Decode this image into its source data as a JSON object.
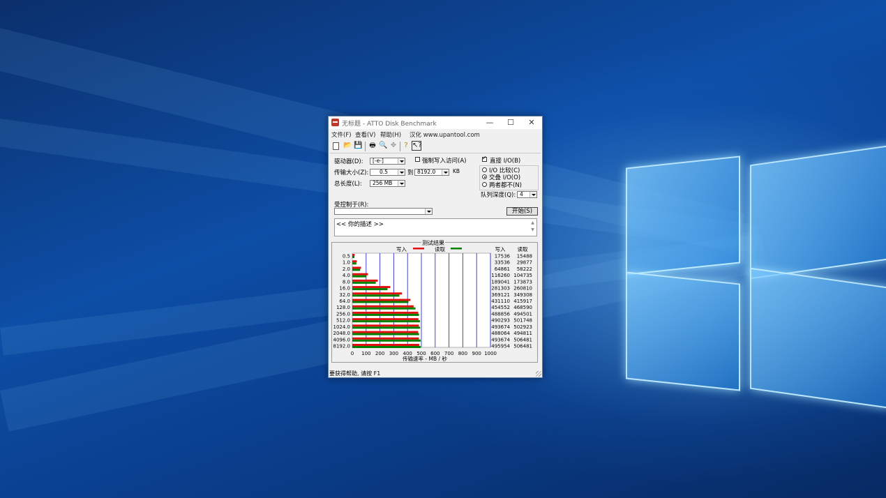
{
  "window": {
    "title": "无标题 - ATTO Disk Benchmark",
    "minimize": "—",
    "maximize": "☐",
    "close": "✕"
  },
  "menu": [
    "文件(F)",
    "查看(V)",
    "帮助(H)",
    "汉化 www.upantool.com"
  ],
  "toolbar": {
    "icons": [
      "new-file-icon",
      "open-folder-icon",
      "save-icon",
      "print-icon",
      "print-preview-icon",
      "move-icon",
      "help-icon",
      "context-help-icon"
    ]
  },
  "settings": {
    "drive_label": "驱动器(D):",
    "drive_value": "[-e-]",
    "force_write_label": "强制写入访问(A)",
    "force_write_checked": false,
    "direct_io_label": "直接 I/O(B)",
    "direct_io_checked": true,
    "transfer_size_label": "传输大小(Z):",
    "transfer_from": "0.5",
    "to_label": "到",
    "transfer_to": "8192.0",
    "kb_label": "KB",
    "total_length_label": "总长度(L):",
    "total_length_value": "256 MB",
    "io_compare_label": "I/O 比较(C)",
    "io_overlap_label": "交叠 I/O(O)",
    "neither_label": "两者都不(N)",
    "selected_mode": "交叠 I/O(O)",
    "queue_depth_label": "队列深度(Q):",
    "queue_depth_value": "4",
    "controlled_by_label": "受控制于(R):",
    "controlled_by_value": "",
    "start_label": "开始(S)",
    "description": "<<  你的描述   >>"
  },
  "chart_data": {
    "type": "bar",
    "title": "测试结果",
    "xlabel": "传输速率 - MB / 秒",
    "xlim": [
      0,
      1000
    ],
    "xticks": [
      "0",
      "100",
      "200",
      "300",
      "400",
      "500",
      "600",
      "700",
      "800",
      "900",
      "1000"
    ],
    "categories": [
      "0.5",
      "1.0",
      "2.0",
      "4.0",
      "8.0",
      "16.0",
      "32.0",
      "64.0",
      "128.0",
      "256.0",
      "512.0",
      "1024.0",
      "2048.0",
      "4096.0",
      "8192.0"
    ],
    "legend": [
      {
        "name": "写入",
        "color": "#e01010"
      },
      {
        "name": "读取",
        "color": "#008000"
      }
    ],
    "table_headers": [
      "写入",
      "读取"
    ],
    "series": [
      {
        "name": "写入",
        "color": "#e01010",
        "values": [
          17536,
          33536,
          64861,
          116260,
          189041,
          281303,
          369121,
          431110,
          454552,
          488856,
          490293,
          493674,
          488064,
          493674,
          495954
        ]
      },
      {
        "name": "读取",
        "color": "#008000",
        "values": [
          15488,
          29877,
          58222,
          104735,
          173873,
          260810,
          349308,
          415917,
          468590,
          494501,
          501748,
          502923,
          494811,
          506481,
          506481
        ]
      }
    ]
  },
  "status": "要获得帮助, 请按 F1"
}
